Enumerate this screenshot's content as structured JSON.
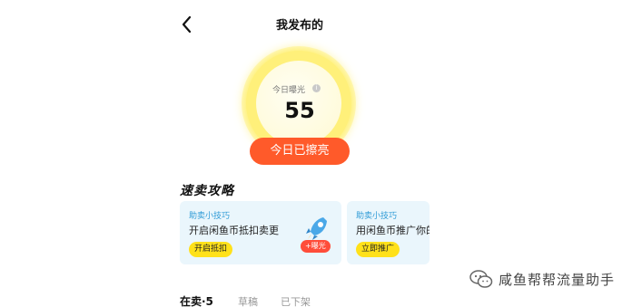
{
  "header": {
    "title": "我发布的"
  },
  "exposure": {
    "label": "今日曝光",
    "info_glyph": "i",
    "value": "55"
  },
  "polish_button": {
    "label": "今日已擦亮"
  },
  "tips_section": {
    "title": "速卖攻略"
  },
  "tip_cards": [
    {
      "tag": "助卖小技巧",
      "description": "开启闲鱼币抵扣卖更",
      "button": "开启抵扣",
      "badge": "+曝光",
      "icon": "rocket-icon"
    },
    {
      "tag": "助卖小技巧",
      "description": "用闲鱼币推广你的",
      "button": "立即推广"
    }
  ],
  "tabs": [
    {
      "label": "在卖·5",
      "active": true
    },
    {
      "label": "草稿",
      "active": false
    },
    {
      "label": "已下架",
      "active": false
    }
  ],
  "watermark": {
    "text": "咸鱼帮帮流量助手",
    "icon": "wechat-icon"
  },
  "colors": {
    "accent_orange": "#ff5a2a",
    "gauge_yellow": "#fff07a",
    "button_yellow": "#ffe11a",
    "card_bg": "#eaf6fc",
    "tag_blue": "#2f9bd6",
    "badge_red": "#ff4d3a"
  }
}
